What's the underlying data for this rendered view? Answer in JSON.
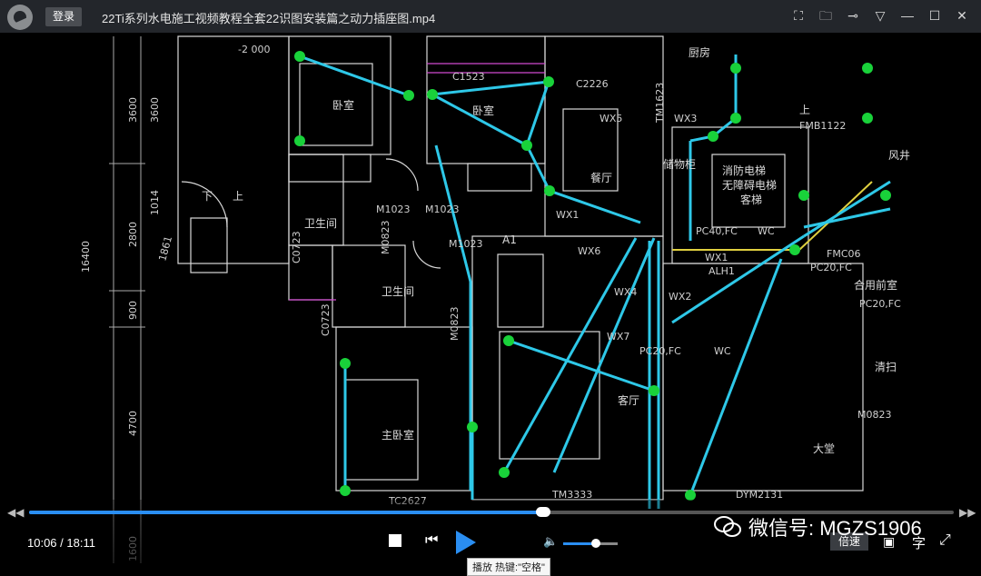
{
  "titlebar": {
    "login_label": "登录",
    "title": "22Ti系列水电施工视频教程全套22识图安装篇之动力插座图.mp4",
    "icons": [
      "screenshot-icon",
      "folder-icon",
      "pin-icon",
      "dropdown-icon",
      "minimize-icon",
      "maximize-icon",
      "close-icon"
    ]
  },
  "drawing": {
    "rooms": {
      "bedroom_top_left": "卧室",
      "bedroom_top_mid": "卧室",
      "kitchen": "厨房",
      "dining": "餐厅",
      "storage": "储物柜",
      "elevator": "消防电梯\n无障碍电梯\n客梯",
      "bath1": "卫生间",
      "bath2": "卫生间",
      "master_bedroom": "主卧室",
      "living": "客厅",
      "lobby": "大堂",
      "front_room": "合用前室",
      "stair_down": "下",
      "stair_up": "上",
      "clean": "清扫",
      "wind": "风井",
      "up2": "上"
    },
    "labels": {
      "door_m1023_a": "M1023",
      "door_m1023_b": "M1023",
      "door_m1023_c": "M1023",
      "door_m0823_a": "M0823",
      "door_m0823_b": "M0823",
      "door_m0823_c": "M0823",
      "c1523": "C1523",
      "c2226": "C2226",
      "c0723_a": "C0723",
      "c0723_b": "C0723",
      "tm1623": "TM1623",
      "tm3333": "TM3333",
      "tc2627": "TC2627",
      "dym2131": "DYM2131",
      "fmb1122": "FMB1122",
      "fmc06": "FMC06",
      "axis_a1": "A1",
      "alh1": "ALH1",
      "wx1": "WX1",
      "wx1b": "WX1",
      "wx2": "WX2",
      "wx3": "WX3",
      "wx4": "WX4",
      "wx5": "WX5",
      "wx6": "WX6",
      "wx7": "WX7",
      "pc20fc": "PC20,FC",
      "pc20fc_b": "PC20,FC",
      "pc20fc_c": "PC20,FC",
      "pc40fc": "PC40,FC",
      "wc1": "WC",
      "wc2": "WC",
      "neg2000": "-2 000",
      "d16400": "16400",
      "d3600a": "3600",
      "d3600b": "3600",
      "d1014": "1014",
      "d2800": "2800",
      "d1861": "1861",
      "d900": "900",
      "d4700": "4700",
      "d1600": "1600"
    }
  },
  "player": {
    "current_time": "10:06",
    "total_time": "18:11",
    "time_display": "10:06 / 18:11",
    "progress": 0.556,
    "volume": 0.6,
    "speed_label": "倍速",
    "subtitle_label": "字",
    "tooltip": "播放 热键:\"空格\"",
    "seek_back": "◀◀",
    "seek_forward": "▶▶"
  },
  "watermark": {
    "text": "微信号: MGZS1906"
  },
  "colors": {
    "accent": "#2a8ef2",
    "wiring": "#2ec8e8",
    "outlet": "#19d23a",
    "walls": "#d8d8d8"
  }
}
